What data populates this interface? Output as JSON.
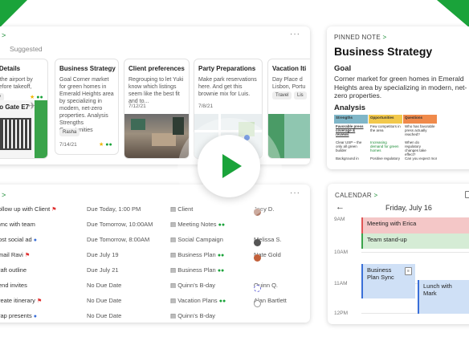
{
  "notes": {
    "suggested_label": "Suggested",
    "menu_label": "···",
    "head_arrow": ">",
    "cards": [
      {
        "title": "t Details",
        "body": "o the airport by\n Before takeoff,",
        "tag": "rity",
        "gate": "Go Gate E7"
      },
      {
        "title": "Business Strategy",
        "body": "Goal Corner market for green homes in Emerald Heights area by specializing in modern, net-zero properties. Analysis Strengths Opportunities",
        "tag": "Rasha",
        "date": "7/14/21"
      },
      {
        "title": "Client preferences",
        "body": "Regrouping to let Yuki know which listings seem like the best fit and to...",
        "date": "7/12/21"
      },
      {
        "title": "Party Preparations",
        "body": "Make park reservations here. And get this brownie mix for Luis.",
        "date": "7/8/21"
      },
      {
        "title": "Vacation Iti",
        "body": "Day Place d Lisbon, Portu",
        "tag": "Travel",
        "tag2": "Lis"
      }
    ]
  },
  "pinned": {
    "header": "PINNED NOTE",
    "arrow": ">",
    "title": "Business Strategy",
    "goal_label": "Goal",
    "goal_text": "Corner market for green homes in Emerald Heights area by specializing in modern, net-zero properties.",
    "analysis_label": "Analysis",
    "table_headers": [
      "Strengths",
      "Opportunities",
      "Questions"
    ],
    "table_rows": [
      [
        "Favorable press coverage & reviews",
        "Few competitors in the area",
        "Who has favorable press actually reached?"
      ],
      [
        "Clear USP – the only all green builder",
        "Increasing demand for green homes",
        "When do regulatory changes take effect?"
      ],
      [
        "Background in",
        "Positive regulatory",
        "Can you expect more"
      ]
    ],
    "colors": {
      "strengths": "#7fb6c8",
      "opportunities": "#f2c84b",
      "questions": "#f08a4b"
    }
  },
  "tasks": {
    "menu_label": "···",
    "head_arrow": ">",
    "rows": [
      {
        "name": "ollow up with Client",
        "flag": "red",
        "due": "Due Today, 1:00 PM",
        "note": "Client",
        "person": "Joey D."
      },
      {
        "name": "ync with team",
        "flag": "",
        "due": "Due Tomorrow, 10:00AM",
        "note": "Meeting Notes",
        "shared": true,
        "person": ""
      },
      {
        "name": "ost social ad",
        "flag": "blue",
        "due": "Due Tomorrow, 8:00AM",
        "note": "Social Campaign",
        "person": "Melissa S."
      },
      {
        "name": "mail Ravi",
        "flag": "red",
        "due": "Due July 19",
        "note": "Business Plan",
        "shared": true,
        "person": "Nate Gold"
      },
      {
        "name": "raft outline",
        "flag": "",
        "due": "Due July 21",
        "note": "Business Plan",
        "shared": true,
        "person": ""
      },
      {
        "name": "end invites",
        "flag": "",
        "due": "No Due Date",
        "note": "Quinn's B-day",
        "person": "Quinn Q."
      },
      {
        "name": "reate itinerary",
        "flag": "red",
        "due": "No Due Date",
        "note": "Vacation Plans",
        "shared": true,
        "person": "Alan Bartlett"
      },
      {
        "name": "rap presents",
        "flag": "blue",
        "due": "No Due Date",
        "note": "Quinn's B-day",
        "person": ""
      }
    ]
  },
  "calendar": {
    "header": "CALENDAR",
    "arrow": ">",
    "date": "Friday, July 16",
    "back_arrow": "←",
    "times": [
      "9AM",
      "10AM",
      "11AM",
      "12PM"
    ],
    "events": [
      {
        "title": "Meeting with Erica"
      },
      {
        "title": "Team stand-up"
      },
      {
        "title": "Business Plan Sync"
      },
      {
        "title": "Lunch with Mark"
      }
    ]
  }
}
